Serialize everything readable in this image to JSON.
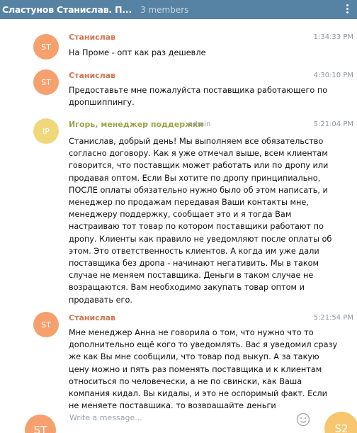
{
  "header": {
    "title": "Сластунов Станислав. П...",
    "members": "3 members"
  },
  "colors": {
    "header_bg": "#5682a3",
    "avatar_st": "#f6a06e",
    "avatar_ip": "#f0d77a",
    "author": "#d0744e",
    "author_admin": "#a0a347"
  },
  "messages": [
    {
      "initials": "ST",
      "author": "Станислав",
      "time": "1:34:33 PM",
      "lines": [
        "На Проме - опт как раз дешевле"
      ]
    },
    {
      "initials": "ST",
      "author": "Станислав",
      "time": "4:30:10 PM",
      "lines": [
        "Предоставьте мне пожалуйста поставщика работающего по",
        "дропшиппингу."
      ]
    },
    {
      "initials": "IP",
      "author": "Игорь, менеджер поддержки",
      "badge": "admin",
      "time": "5:21:04 PM",
      "lines": [
        "Станислав, добрый день! Мы выполняем все обязательство",
        "согласно договору.  Как я уже отмечал выше, всем клиентам",
        "говорится, что поставщик может работать или по дропу или",
        "продавая оптом. Если Вы хотите по дропу принципиально,",
        "ПОСЛЕ оплаты обязательно нужно было об этом написать, и",
        "менеджер по продажам передавая Ваши контакты мне,",
        "менеджеру поддержку, сообщает это и я тогда Вам",
        "настраиваю тот товар по котором поставщики работают по",
        "дропу. Клиенты как правило не уведомляют после оплаты об",
        "этом. Это ответственность клиентов. А когда им уже дали",
        "поставщика без дропа - начинают негативить. Мы в таком",
        "случае не меняем поставщика. Деньги в таком случае не",
        "возращаются. Вам необходимо закупать товар оптом и",
        "продавать его."
      ]
    },
    {
      "initials": "ST",
      "author": "Станислав",
      "time": "5:21:54 PM",
      "lines": [
        "Мне менеджер Анна не говорила о том, что нужно что то",
        "дополнительно ещё кого то уведомлять. Вас я уведомил сразу",
        "же как Вы мне сообщили, что товар под выкуп. А за такую",
        "цену можно и пять раз поменять поставщика и к клиентам",
        "относиться по человечески, а не по свински, как Ваша",
        "компания кидал. Вы кидалы, и это не оспоримый факт. Если",
        "не меняете поставщика, то возвращайте деньги"
      ]
    }
  ],
  "composer": {
    "placeholder": "Write a message...",
    "my_initials": "ST",
    "send_initials": "S2"
  }
}
